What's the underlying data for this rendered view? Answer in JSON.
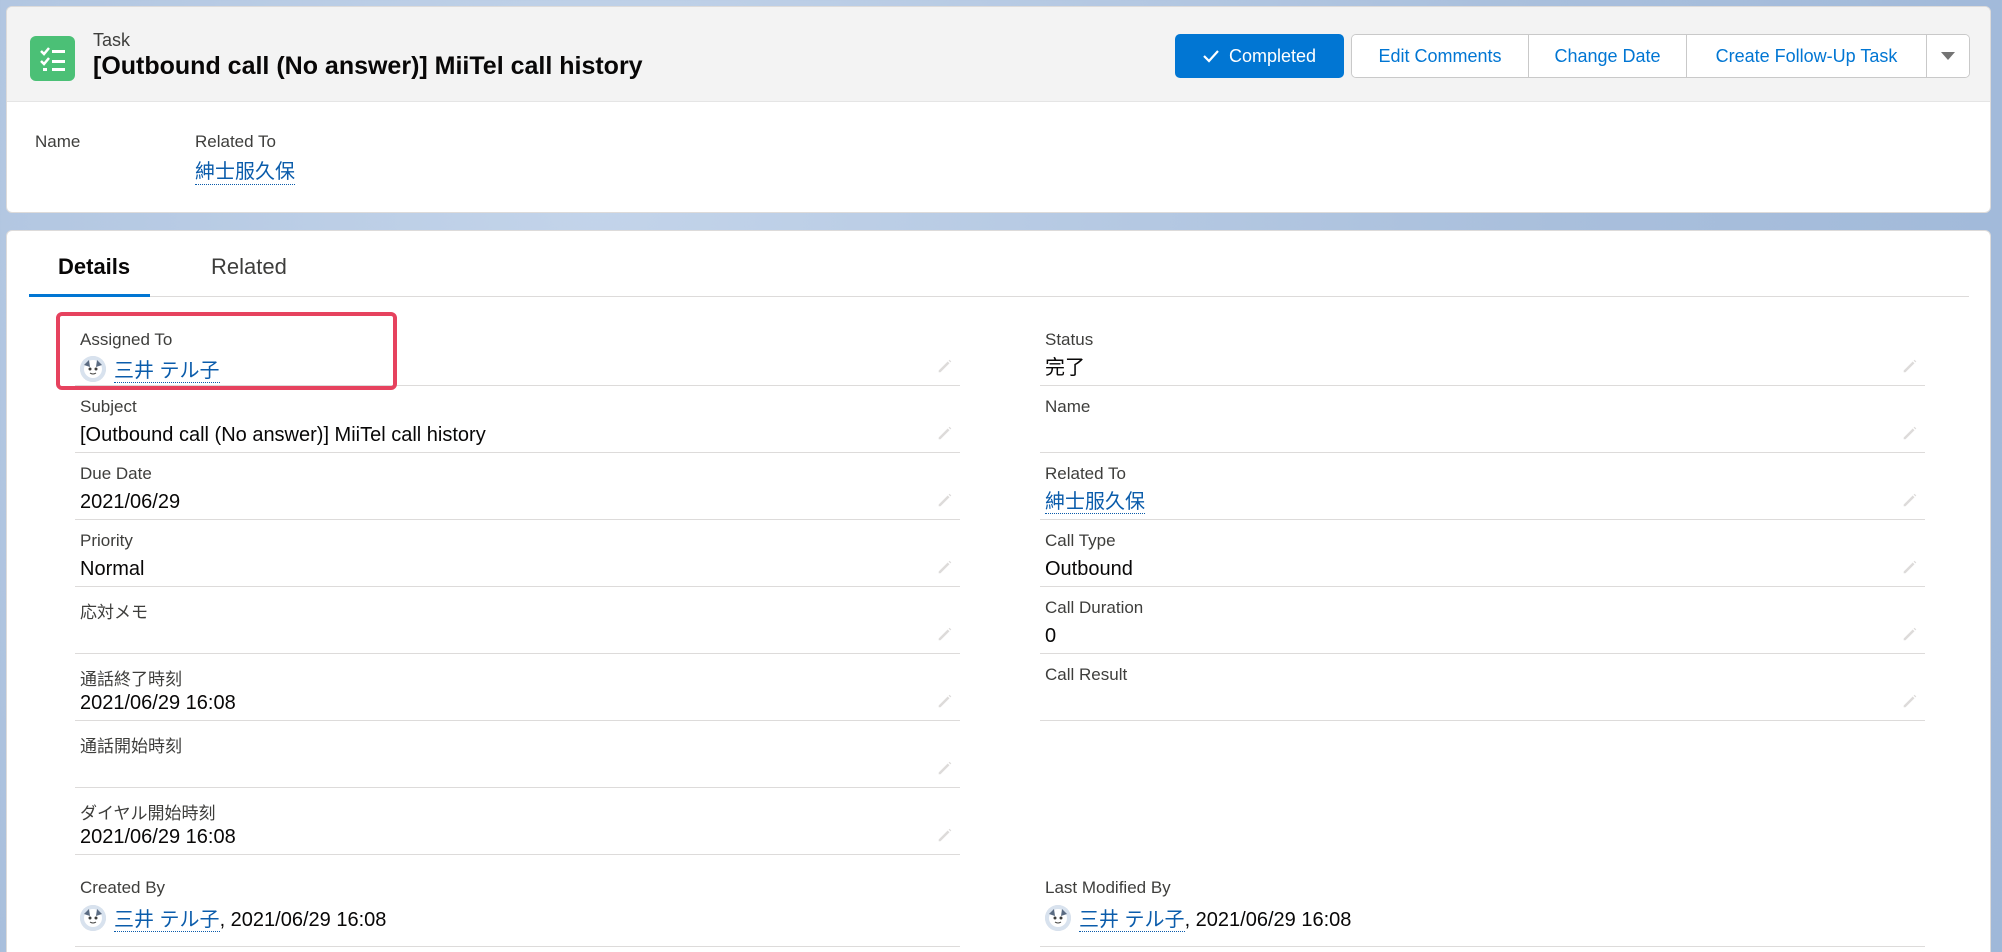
{
  "header": {
    "object_label": "Task",
    "title": "[Outbound call (No answer)] MiiTel call history",
    "actions": {
      "completed": "Completed",
      "edit_comments": "Edit Comments",
      "change_date": "Change Date",
      "follow_up": "Create Follow-Up Task"
    },
    "highlights": {
      "name_label": "Name",
      "related_label": "Related To",
      "related_value": "紳士服久保"
    }
  },
  "tabs": {
    "details": "Details",
    "related": "Related"
  },
  "left_fields": [
    {
      "label": "Assigned To",
      "value": "三井 テル子"
    },
    {
      "label": "Subject",
      "value": "[Outbound call (No answer)] MiiTel call history"
    },
    {
      "label": "Due Date",
      "value": "2021/06/29"
    },
    {
      "label": "Priority",
      "value": "Normal"
    },
    {
      "label": "応対メモ",
      "value": ""
    },
    {
      "label": "通話終了時刻",
      "value": "2021/06/29 16:08"
    },
    {
      "label": "通話開始時刻",
      "value": ""
    },
    {
      "label": "ダイヤル開始時刻",
      "value": "2021/06/29 16:08"
    }
  ],
  "right_fields": [
    {
      "label": "Status",
      "value": "完了"
    },
    {
      "label": "Name",
      "value": ""
    },
    {
      "label": "Related To",
      "value": "紳士服久保"
    },
    {
      "label": "Call Type",
      "value": "Outbound"
    },
    {
      "label": "Call Duration",
      "value": "0"
    },
    {
      "label": "Call Result",
      "value": ""
    }
  ],
  "system": {
    "created_by_label": "Created By",
    "created_by_user": "三井 テル子",
    "created_by_date": ", 2021/06/29 16:08",
    "modified_by_label": "Last Modified By",
    "modified_by_user": "三井 テル子",
    "modified_by_date": ", 2021/06/29 16:08"
  },
  "colors": {
    "brand": "#0176d3",
    "task_icon": "#4bc076",
    "highlight_box": "#e6425e"
  }
}
